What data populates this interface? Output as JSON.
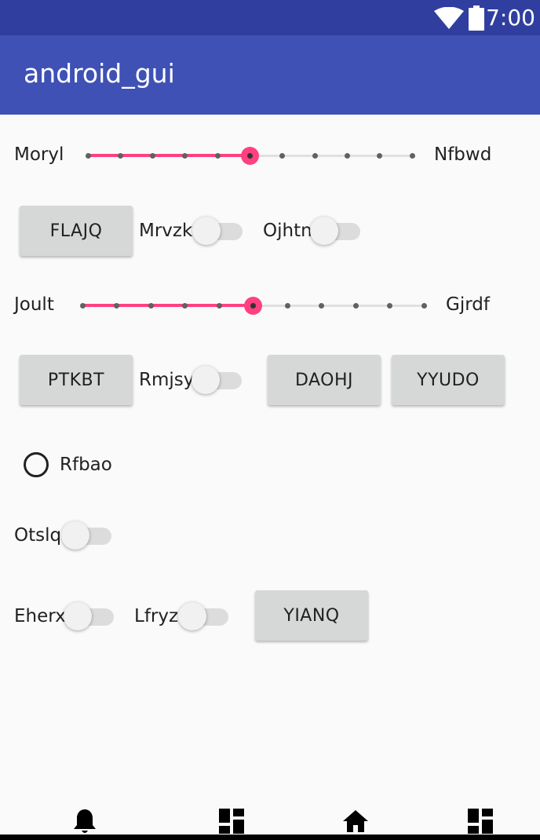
{
  "status_bar": {
    "time": "7:00",
    "wifi_icon": "wifi-icon",
    "battery_icon": "battery-icon"
  },
  "app_bar": {
    "title": "android_gui"
  },
  "row1": {
    "label_left": "Moryl",
    "label_right": "Nfbwd",
    "seekbar": {
      "steps": 10,
      "value": 5,
      "accent": "#ff4081"
    }
  },
  "row2": {
    "button": "FLAJQ",
    "switch1_label": "Mrvzk",
    "switch1_on": false,
    "switch2_label": "Ojhtn",
    "switch2_on": false
  },
  "row3": {
    "label_left": "Joult",
    "label_right": "Gjrdf",
    "seekbar": {
      "steps": 10,
      "value": 5,
      "accent": "#ff4081"
    }
  },
  "row4": {
    "button1": "PTKBT",
    "switch_label": "Rmjsy",
    "switch_on": false,
    "button2": "DAOHJ",
    "button3": "YYUDO"
  },
  "row5": {
    "radio_label": "Rfbao",
    "radio_checked": false
  },
  "row6": {
    "switch_label": "Otslq",
    "switch_on": false
  },
  "row7": {
    "switch1_label": "Eherx",
    "switch1_on": false,
    "switch2_label": "Lfryz",
    "switch2_on": false,
    "button": "YIANQ"
  },
  "bottom_nav": {
    "icons": [
      "bell-icon",
      "dashboard-icon",
      "home-icon",
      "dashboard-icon"
    ]
  },
  "colors": {
    "status_bar": "#303f9f",
    "app_bar": "#3f51b5",
    "accent": "#ff4081",
    "background": "#fafafa",
    "button": "#d6d7d7"
  }
}
